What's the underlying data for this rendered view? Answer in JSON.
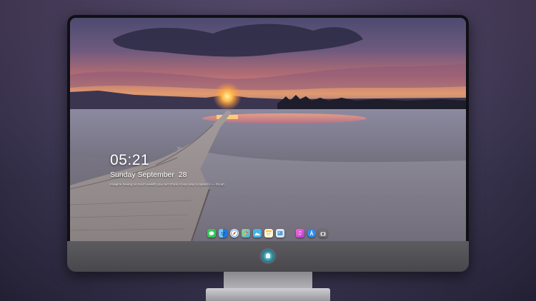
{
  "lock_screen": {
    "time": "05:21",
    "date": "Sunday September  28",
    "note": "Imagine having so much wealth you can't think of any way to spend it — it's art"
  },
  "dock": {
    "apps": [
      {
        "name": "messages",
        "icon": "messages-icon",
        "color": "#34c759"
      },
      {
        "name": "finder",
        "icon": "finder-icon",
        "color": "#1e90ff"
      },
      {
        "name": "safari",
        "icon": "safari-icon",
        "color": "#f2f2f2"
      },
      {
        "name": "maps",
        "icon": "maps-icon",
        "color": "#6fbf73"
      },
      {
        "name": "photos",
        "icon": "photos-icon",
        "color": "#4ab3e6"
      },
      {
        "name": "notes",
        "icon": "notes-icon",
        "color": "#f5d94a"
      },
      {
        "name": "preview",
        "icon": "preview-icon",
        "color": "#5aa0d8"
      },
      {
        "name": "itunes",
        "icon": "music-icon",
        "color": "#e04ad0"
      },
      {
        "name": "app-store",
        "icon": "app-store-icon",
        "color": "#2d8cf0"
      },
      {
        "name": "camera",
        "icon": "camera-icon",
        "color": "#6e6e73"
      }
    ]
  },
  "monitor": {
    "brand_logo": "alien-logo-icon"
  }
}
